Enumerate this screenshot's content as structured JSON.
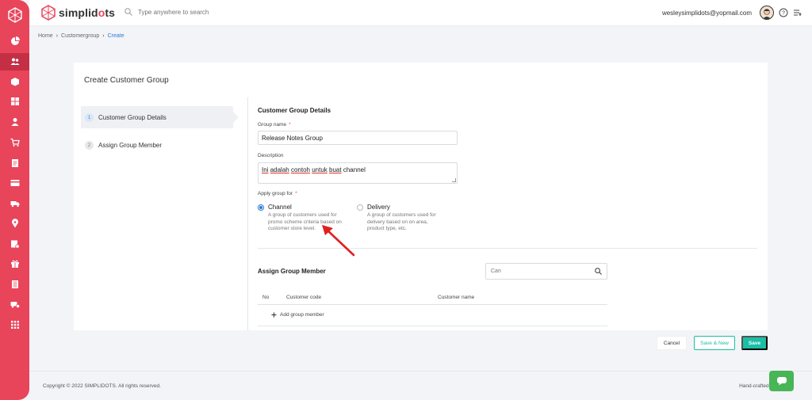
{
  "brand": {
    "prefix": "simplid",
    "accent": "o",
    "suffix": "ts"
  },
  "search": {
    "placeholder": "Type anywhere to search"
  },
  "user": {
    "email": "wesleysimplidots@yopmail.com"
  },
  "sidebar": {
    "items": [
      {
        "name": "dashboard-icon"
      },
      {
        "name": "users-icon",
        "active": true
      },
      {
        "name": "box-icon"
      },
      {
        "name": "grid-icon"
      },
      {
        "name": "person-icon"
      },
      {
        "name": "cart-icon"
      },
      {
        "name": "document-icon"
      },
      {
        "name": "card-icon"
      },
      {
        "name": "truck-icon"
      },
      {
        "name": "location-icon"
      },
      {
        "name": "store-icon"
      },
      {
        "name": "gift-icon"
      },
      {
        "name": "report-icon"
      },
      {
        "name": "van-icon"
      },
      {
        "name": "apps-icon"
      }
    ]
  },
  "breadcrumb": {
    "home": "Home",
    "section": "Customergroup",
    "current": "Create"
  },
  "page": {
    "title": "Create Customer Group"
  },
  "steps": [
    {
      "number": "1",
      "label": "Customer Group Details"
    },
    {
      "number": "2",
      "label": "Assign Group Member"
    }
  ],
  "details": {
    "section_title": "Customer Group Details",
    "group_name_label": "Group name",
    "group_name_value": "Release Notes Group",
    "description_label": "Description",
    "description_words": [
      "Ini",
      "adalah",
      "contoh",
      "untuk",
      "buat"
    ],
    "description_tail": "channel",
    "apply_label": "Apply group for",
    "required_mark": "*",
    "options": [
      {
        "title": "Channel",
        "desc": "A group of customers used for promo scheme criteria based on customer store level.",
        "selected": true
      },
      {
        "title": "Delivery",
        "desc": "A group of customers used for delivery based on on area, product type, etc.",
        "selected": false
      }
    ]
  },
  "members": {
    "section_title": "Assign Group Member",
    "search_placeholder": "Cari",
    "columns": [
      "No",
      "Customer code",
      "Customer name"
    ],
    "add_label": "Add group member"
  },
  "actions": {
    "cancel": "Cancel",
    "save_new": "Save & New",
    "save": "Save"
  },
  "footer": {
    "copyright": "Copyright © 2022 SIMPLIDOTS. All rights reserved.",
    "handcrafted": "Hand-crafted & m"
  },
  "colors": {
    "sidebar": "#e8445a",
    "accent": "#1bbfa5",
    "link": "#2a7ad6",
    "annotation": "#e02020"
  }
}
